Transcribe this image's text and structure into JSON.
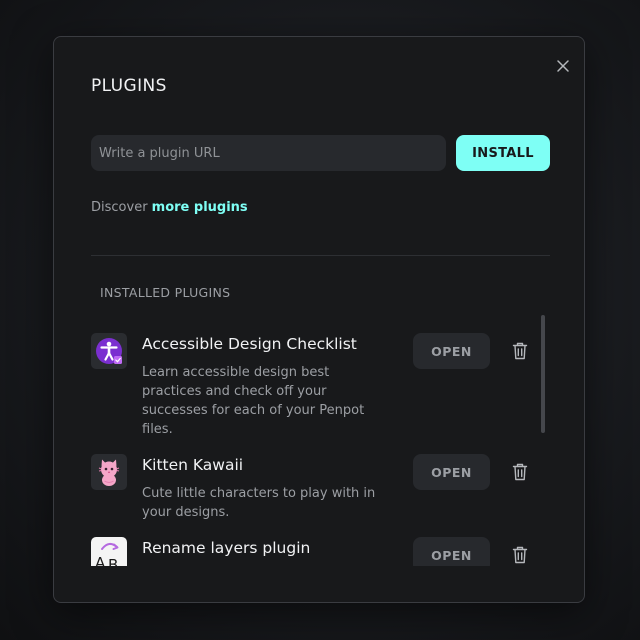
{
  "modal": {
    "title": "PLUGINS",
    "close_icon": "close-icon"
  },
  "install": {
    "placeholder": "Write a plugin URL",
    "value": "",
    "button_label": "INSTALL",
    "accent_color": "#7efff5"
  },
  "discover": {
    "prefix": "Discover ",
    "link_label": "more plugins"
  },
  "installed": {
    "section_title": "INSTALLED PLUGINS",
    "plugins": [
      {
        "name": "Accessible Design Checklist",
        "description": "Learn accessible design best practices and check off your successes for each of your Penpot files.",
        "open_label": "OPEN",
        "icon": "accessibility-icon"
      },
      {
        "name": "Kitten Kawaii",
        "description": "Cute little characters to play with in your designs.",
        "open_label": "OPEN",
        "icon": "kitten-icon"
      },
      {
        "name": "Rename layers plugin",
        "description": "",
        "open_label": "OPEN",
        "icon": "rename-layers-icon"
      }
    ]
  }
}
